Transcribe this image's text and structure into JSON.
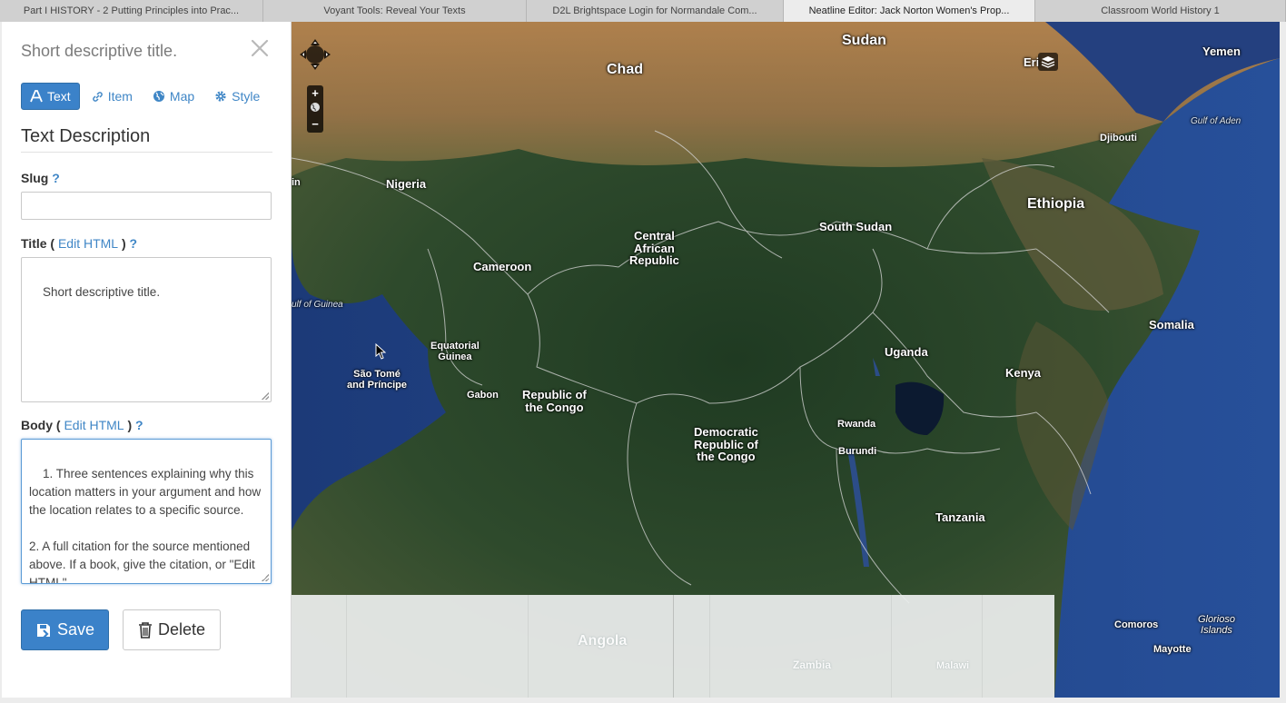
{
  "browser": {
    "tabs": [
      {
        "title": "Part I HISTORY - 2 Putting Principles into Prac...",
        "active": false
      },
      {
        "title": "Voyant Tools: Reveal Your Texts",
        "active": false
      },
      {
        "title": "D2L Brightspace Login for Normandale Com...",
        "active": false
      },
      {
        "title": "Neatline Editor: Jack Norton Women's Prop...",
        "active": true
      },
      {
        "title": "Classroom World History 1",
        "active": false
      }
    ]
  },
  "editor": {
    "header_title": "Short descriptive title.",
    "tabs": [
      {
        "label": "Text",
        "icon": "font-icon",
        "active": true
      },
      {
        "label": "Item",
        "icon": "link-icon",
        "active": false
      },
      {
        "label": "Map",
        "icon": "globe-icon",
        "active": false
      },
      {
        "label": "Style",
        "icon": "gear-icon",
        "active": false
      }
    ],
    "section_title": "Text Description",
    "slug": {
      "label": "Slug",
      "help": "?",
      "value": ""
    },
    "title_field": {
      "label": "Title (",
      "edit_html": "Edit HTML",
      "label_close": ")",
      "help": "?",
      "value": "Short descriptive title."
    },
    "body_field": {
      "label": "Body (",
      "edit_html": "Edit HTML",
      "label_close": ")",
      "help": "?",
      "value": "1. Three sentences explaining why this location matters in your argument and how the location relates to a specific source.\n\n2. A full citation for the source mentioned above. If a book, give the citation, or \"Edit HTML\""
    },
    "save_label": "Save",
    "delete_label": "Delete",
    "colors": {
      "primary": "#3b82c9",
      "link": "#3f86c6"
    }
  },
  "map": {
    "labels": {
      "sudan": "Sudan",
      "chad": "Chad",
      "yemen": "Yemen",
      "eritrea": "Eri",
      "djibouti": "Djibouti",
      "gulf_aden": "Gulf of Aden",
      "ethiopia": "Ethiopia",
      "nigeria": "Nigeria",
      "benin_partial": "in",
      "car": "Central\nAfrican\nRepublic",
      "south_sudan": "South Sudan",
      "cameroon": "Cameroon",
      "gulf_guinea": "ulf of Guinea",
      "somalia": "Somalia",
      "uganda": "Uganda",
      "eq_guinea": "Equatorial\nGuinea",
      "sao_tome": "São Tomé\nand Príncipe",
      "kenya": "Kenya",
      "gabon": "Gabon",
      "rep_congo": "Republic of\nthe Congo",
      "drc": "Democratic\nRepublic of\nthe Congo",
      "rwanda": "Rwanda",
      "burundi": "Burundi",
      "tanzania": "Tanzania",
      "angola": "Angola",
      "zambia": "Zambia",
      "malawi": "Malawi",
      "comoros": "Comoros",
      "glorioso": "Glorioso\nIslands",
      "mayotte": "Mayotte"
    },
    "zoom_in": "+",
    "zoom_out": "−"
  }
}
